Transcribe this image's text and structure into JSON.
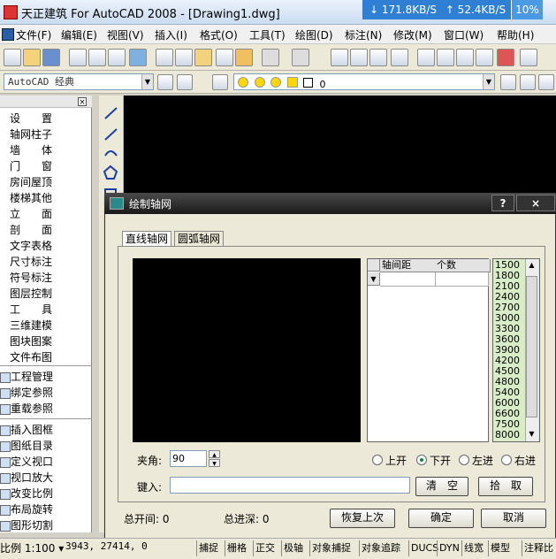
{
  "window": {
    "title": "天正建筑 For AutoCAD 2008 - [Drawing1.dwg]",
    "net_down": "↓ 171.8KB/S",
    "net_up": "↑ 52.4KB/S",
    "net_pct": "10%"
  },
  "menu": [
    "文件(F)",
    "编辑(E)",
    "视图(V)",
    "插入(I)",
    "格式(O)",
    "工具(T)",
    "绘图(D)",
    "标注(N)",
    "修改(M)",
    "窗口(W)",
    "帮助(H)"
  ],
  "toolbar2": {
    "workspace": "AutoCAD 经典",
    "layer_value": "0"
  },
  "left_panel": {
    "items": [
      "设　　置",
      "轴网柱子",
      "墙　　体",
      "门　　窗",
      "房间屋顶",
      "楼梯其他",
      "立　　面",
      "剖　　面",
      "文字表格",
      "尺寸标注",
      "符号标注",
      "图层控制",
      "工　　具",
      "三维建模",
      "图块图案",
      "文件布图"
    ],
    "sub_items": [
      "工程管理",
      "绑定参照",
      "重载参照",
      "插入图框",
      "图纸目录",
      "定义视口",
      "视口放大",
      "改变比例",
      "布局旋转",
      "图形切割"
    ]
  },
  "dialog": {
    "title": "绘制轴网",
    "help": "?",
    "close": "×",
    "tabs": [
      "直线轴网",
      "圆弧轴网"
    ],
    "grid_headers": [
      "轴间距",
      "个数"
    ],
    "values": [
      "1500",
      "1800",
      "2100",
      "2400",
      "2700",
      "3000",
      "3300",
      "3600",
      "3900",
      "4200",
      "4500",
      "4800",
      "5400",
      "6000",
      "6600",
      "7500",
      "8000"
    ],
    "angle_label": "夹角:",
    "angle_value": "90",
    "radios": [
      {
        "label": "上开",
        "selected": false
      },
      {
        "label": "下开",
        "selected": true
      },
      {
        "label": "左进",
        "selected": false
      },
      {
        "label": "右进",
        "selected": false
      }
    ],
    "key_label": "键入:",
    "clear_btn": "清　空",
    "pick_btn": "拾　取",
    "total_bay": "总开间: 0",
    "total_depth": "总进深: 0",
    "restore_btn": "恢复上次",
    "ok_btn": "确定",
    "cancel_btn": "取消"
  },
  "status": {
    "scale": "比例 1:100 ▾",
    "coords": "3943,   27414,  0",
    "buttons": [
      "捕捉",
      "栅格",
      "正交",
      "极轴",
      "对象捕捉",
      "对象追踪",
      "DUCS",
      "DYN",
      "线宽",
      "模型",
      "注释比"
    ]
  }
}
